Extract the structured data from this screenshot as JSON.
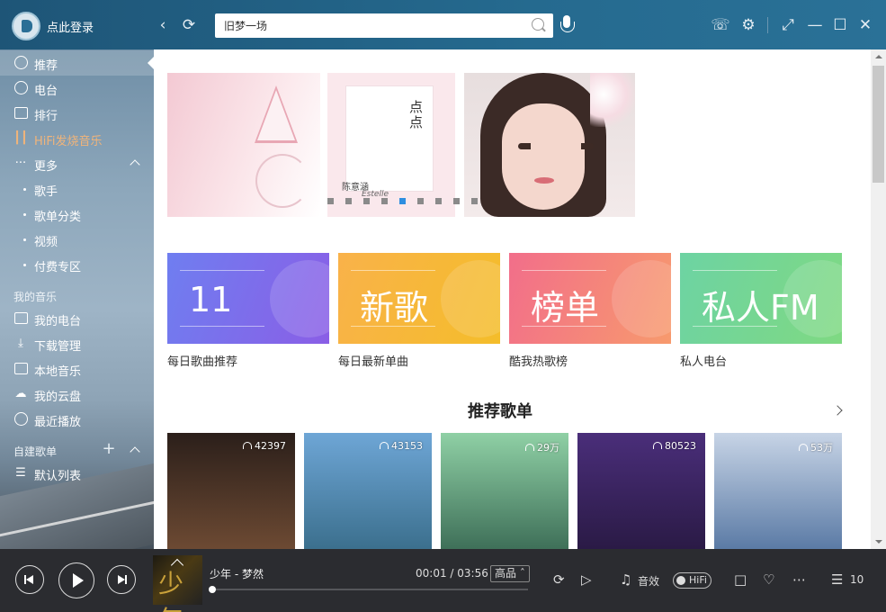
{
  "header": {
    "login_label": "点此登录",
    "search": {
      "value": "旧梦一场",
      "placeholder": ""
    }
  },
  "sidebar": {
    "nav": [
      {
        "label": "推荐",
        "icon": "disc-icon",
        "active": true
      },
      {
        "label": "电台",
        "icon": "radio-icon"
      },
      {
        "label": "排行",
        "icon": "chart-icon"
      },
      {
        "label": "HiFi发烧音乐",
        "icon": "waveform-icon",
        "color": "#f0b47a"
      },
      {
        "label": "更多",
        "icon": "more-dots-icon",
        "expanded": true
      }
    ],
    "more_items": [
      "歌手",
      "歌单分类",
      "视频",
      "付费专区"
    ],
    "my_music_title": "我的音乐",
    "my_music": [
      {
        "label": "我的电台",
        "icon": "radio-box-icon"
      },
      {
        "label": "下载管理",
        "icon": "download-icon"
      },
      {
        "label": "本地音乐",
        "icon": "monitor-icon"
      },
      {
        "label": "我的云盘",
        "icon": "cloud-icon"
      },
      {
        "label": "最近播放",
        "icon": "clock-icon"
      }
    ],
    "created_title": "自建歌单",
    "created": [
      {
        "label": "默认列表",
        "icon": "list-icon"
      }
    ]
  },
  "banners": {
    "mid": {
      "title_lines": "点点",
      "artist": "陈意涵",
      "artist_en": "Estelle"
    },
    "dots_total": 9,
    "dots_active_index": 4
  },
  "features": [
    {
      "text": "11",
      "caption": "每日歌曲推荐",
      "from": "#6f7ef0",
      "to": "#8a5ee6"
    },
    {
      "text": "新歌",
      "caption": "每日最新单曲",
      "from": "#f9b24a",
      "to": "#f4bd2a"
    },
    {
      "text": "榜单",
      "caption": "酷我热歌榜",
      "from": "#f26e8a",
      "to": "#f79a6d"
    },
    {
      "text": "私人FM",
      "caption": "私人电台",
      "from": "#6dd3a3",
      "to": "#7fd982"
    }
  ],
  "section": {
    "title": "推荐歌单"
  },
  "playlists": [
    {
      "count": "42397",
      "bg_from": "#2b1f1a",
      "bg_to": "#6d4a33"
    },
    {
      "count": "43153",
      "bg_from": "#6ea6d6",
      "bg_to": "#3b6f8d"
    },
    {
      "count": "29万",
      "bg_from": "#8fd0a5",
      "bg_to": "#3e6f58"
    },
    {
      "count": "80523",
      "bg_from": "#4a2e7a",
      "bg_to": "#2a1a45"
    },
    {
      "count": "53万",
      "bg_from": "#c7d4e6",
      "bg_to": "#5a7aa5"
    }
  ],
  "player": {
    "song": "少年 - 梦然",
    "current": "00:01",
    "duration": "03:56",
    "time_text": "00:01 / 03:56",
    "progress": 0.004,
    "quality": "高品",
    "sound_label": "音效",
    "hifi_label": "HiFi",
    "queue_count": "10",
    "cover_glyph": "少年"
  }
}
